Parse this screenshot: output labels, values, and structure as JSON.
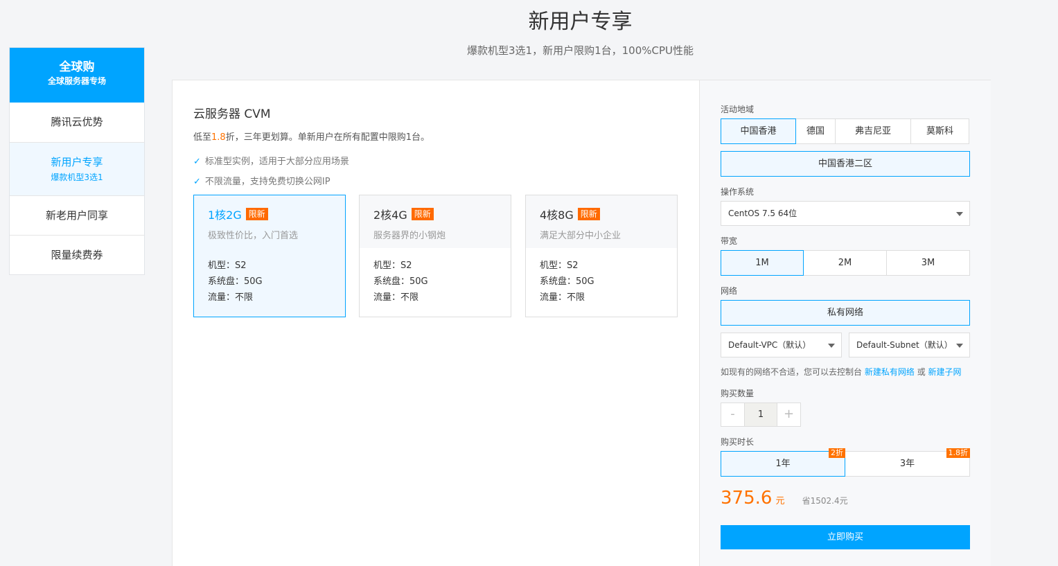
{
  "header": {
    "title": "新用户专享",
    "subtitle": "爆款机型3选1，新用户限购1台，100%CPU性能"
  },
  "sidebar": {
    "head_title": "全球购",
    "head_sub": "全球服务器专场",
    "items": [
      {
        "label": "腾讯云优势"
      },
      {
        "label": "新用户专享",
        "sub": "爆款机型3选1"
      },
      {
        "label": "新老用户同享"
      },
      {
        "label": "限量续费券"
      }
    ]
  },
  "product": {
    "title": "云服务器 CVM",
    "desc_pre": "低至",
    "desc_discount": "1.8",
    "desc_post": "折，三年更划算。单新用户在所有配置中限购1台。",
    "features": [
      "标准型实例，适用于大部分应用场景",
      "不限流量，支持免费切换公网IP"
    ],
    "cards": [
      {
        "name": "1核2G",
        "tag": "限新",
        "sub": "极致性价比，入门首选",
        "model": "机型：S2",
        "disk": "系统盘：50G",
        "traffic": "流量：不限"
      },
      {
        "name": "2核4G",
        "tag": "限新",
        "sub": "服务器界的小钢炮",
        "model": "机型：S2",
        "disk": "系统盘：50G",
        "traffic": "流量：不限"
      },
      {
        "name": "4核8G",
        "tag": "限新",
        "sub": "满足大部分中小企业",
        "model": "机型：S2",
        "disk": "系统盘：50G",
        "traffic": "流量：不限"
      }
    ]
  },
  "config": {
    "region_label": "活动地域",
    "regions": [
      "中国香港",
      "德国",
      "弗吉尼亚",
      "莫斯科"
    ],
    "zone": "中国香港二区",
    "os_label": "操作系统",
    "os_value": "CentOS 7.5 64位",
    "bw_label": "带宽",
    "bandwidths": [
      "1M",
      "2M",
      "3M"
    ],
    "net_label": "网络",
    "net_type": "私有网络",
    "vpc": "Default-VPC（默认）",
    "subnet": "Default-Subnet（默认）",
    "hint_pre": "如现有的网络不合适，您可以去控制台",
    "hint_link1": "新建私有网络",
    "hint_or": "或",
    "hint_link2": "新建子网",
    "qty_label": "购买数量",
    "qty_minus": "-",
    "qty_value": "1",
    "qty_plus": "+",
    "dur_label": "购买时长",
    "durations": [
      {
        "label": "1年",
        "badge": "2折"
      },
      {
        "label": "3年",
        "badge": "1.8折"
      }
    ],
    "price": "375.6",
    "price_unit": "元",
    "save": "省1502.4元",
    "buy_label": "立即购买"
  }
}
